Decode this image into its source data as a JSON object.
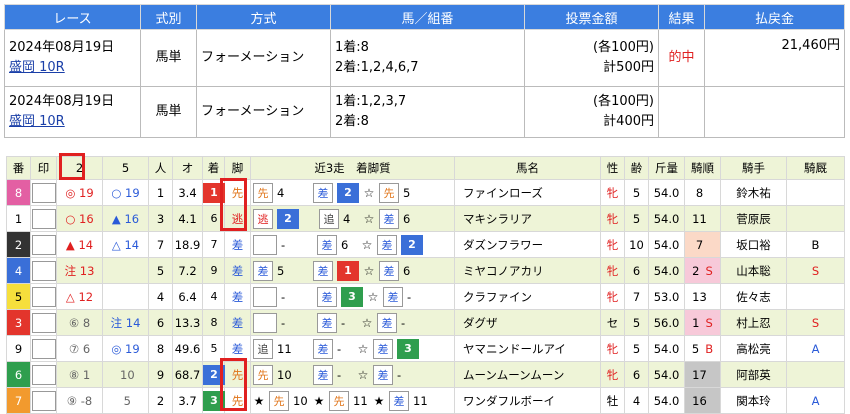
{
  "results": {
    "headers": [
      "レース",
      "式別",
      "方式",
      "馬／組番",
      "投票金額",
      "結果",
      "払戻金"
    ],
    "rows": [
      {
        "date": "2024年08月19日",
        "race": "盛岡 10R",
        "type": "馬単",
        "method": "フォーメーション",
        "combo1": "1着:8",
        "combo2": "2着:1,2,4,6,7",
        "amt1": "(各100円)",
        "amt2": "計500円",
        "result": "的中",
        "payout": "21,460円"
      },
      {
        "date": "2024年08月19日",
        "race": "盛岡 10R",
        "type": "馬単",
        "method": "フォーメーション",
        "combo1": "1着:1,2,3,7",
        "combo2": "2着:8",
        "amt1": "(各100円)",
        "amt2": "計400円",
        "result": "",
        "payout": ""
      }
    ]
  },
  "entries": {
    "headers": {
      "ban": "番",
      "mark": "印",
      "c2": "2",
      "c5": "5",
      "pop": "人",
      "odds": "オ",
      "finish": "着",
      "leg": "脚",
      "past": "近3走　着脚質",
      "name": "馬名",
      "sex": "性",
      "age": "齢",
      "weight": "斤量",
      "rider_rank": "騎順",
      "jockey": "騎手",
      "stable": "騎厩"
    },
    "rows": [
      {
        "ban": "8",
        "m2s": "◎",
        "m2n": "19",
        "m5s": "○",
        "m5n": "19",
        "pop": "1",
        "odds": "3.4",
        "fin": "1",
        "leg": "先",
        "p1s": "先",
        "p1n": "4",
        "p2s": "差",
        "p2n": "2",
        "p2f": "2",
        "p3star": "☆",
        "p3s": "先",
        "p3n": "5",
        "name": "ファインローズ",
        "sex": "牝",
        "age": "5",
        "wt": "54.0",
        "rr": "8",
        "rr_s": "",
        "jockey": "鈴木祐",
        "stable": ""
      },
      {
        "ban": "1",
        "m2s": "○",
        "m2n": "16",
        "m5s": "▲",
        "m5n": "16",
        "pop": "3",
        "odds": "4.1",
        "fin": "6",
        "leg": "逃",
        "p1s": "逃",
        "p1n": "2",
        "p1f": "2",
        "p2s": "追",
        "p2n": "4",
        "p3star": "☆",
        "p3s": "差",
        "p3n": "6",
        "name": "マキシラリア",
        "sex": "牝",
        "age": "5",
        "wt": "54.0",
        "rr": "11",
        "rr_s": "",
        "jockey": "菅原辰",
        "stable": ""
      },
      {
        "ban": "2",
        "m2s": "▲",
        "m2n": "14",
        "m5s": "△",
        "m5n": "14",
        "pop": "7",
        "odds": "18.9",
        "fin": "7",
        "leg": "差",
        "p1s": "",
        "p1n": "-",
        "p2s": "差",
        "p2n": "6",
        "p3star": "☆",
        "p3s": "差",
        "p3n": "2",
        "p3f": "2",
        "name": "ダズンフラワー",
        "sex": "牝",
        "age": "10",
        "wt": "54.0",
        "rr": "7",
        "rr_s": "",
        "jockey": "坂口裕",
        "stable": "B"
      },
      {
        "ban": "4",
        "m2s": "注",
        "m2n": "13",
        "m5s": "",
        "m5n": "",
        "pop": "5",
        "odds": "7.2",
        "fin": "9",
        "leg": "差",
        "p1s": "差",
        "p1n": "5",
        "p2s": "差",
        "p2n": "1",
        "p2f": "1",
        "p3star": "☆",
        "p3s": "差",
        "p3n": "6",
        "name": "ミヤコノアカリ",
        "sex": "牝",
        "age": "6",
        "wt": "54.0",
        "rr": "2",
        "rr_s": "S",
        "jockey": "山本聡",
        "stable": "S"
      },
      {
        "ban": "5",
        "m2s": "△",
        "m2n": "12",
        "m5s": "",
        "m5n": "",
        "pop": "4",
        "odds": "6.4",
        "fin": "4",
        "leg": "差",
        "p1s": "",
        "p1n": "-",
        "p2s": "差",
        "p2n": "3",
        "p2f": "3",
        "p3star": "☆",
        "p3s": "差",
        "p3n": "-",
        "name": "クラファイン",
        "sex": "牝",
        "age": "7",
        "wt": "53.0",
        "rr": "13",
        "rr_s": "",
        "jockey": "佐々志",
        "stable": ""
      },
      {
        "ban": "3",
        "m2s": "⑥",
        "m2n": "8",
        "m5s": "注",
        "m5n": "14",
        "pop": "6",
        "odds": "13.3",
        "fin": "8",
        "leg": "差",
        "p1s": "",
        "p1n": "-",
        "p2s": "差",
        "p2n": "-",
        "p3star": "☆",
        "p3s": "差",
        "p3n": "-",
        "name": "ダグザ",
        "sex": "セ",
        "age": "5",
        "wt": "56.0",
        "rr": "1",
        "rr_s": "S",
        "jockey": "村上忍",
        "stable": "S"
      },
      {
        "ban": "9",
        "m2s": "⑦",
        "m2n": "6",
        "m5s": "◎",
        "m5n": "19",
        "pop": "8",
        "odds": "49.6",
        "fin": "5",
        "leg": "差",
        "p1s": "追",
        "p1n": "11",
        "p2s": "差",
        "p2n": "-",
        "p3star": "☆",
        "p3s": "差",
        "p3n": "3",
        "p3f": "3",
        "name": "ヤマニンドールアイ",
        "sex": "牝",
        "age": "5",
        "wt": "54.0",
        "rr": "5",
        "rr_s": "B",
        "jockey": "高松亮",
        "stable": "A"
      },
      {
        "ban": "6",
        "m2s": "⑧",
        "m2n": "1",
        "m5s": "",
        "m5n": "10",
        "pop": "9",
        "odds": "68.7",
        "fin": "2",
        "leg": "先",
        "p1s": "先",
        "p1n": "10",
        "p2s": "差",
        "p2n": "-",
        "p3star": "☆",
        "p3s": "差",
        "p3n": "-",
        "name": "ムーンムーンムーン",
        "sex": "牝",
        "age": "6",
        "wt": "54.0",
        "rr": "17",
        "rr_s": "",
        "jockey": "阿部英",
        "stable": ""
      },
      {
        "ban": "7",
        "m2s": "⑨",
        "m2n": "-8",
        "m5s": "",
        "m5n": "5",
        "pop": "2",
        "odds": "3.7",
        "fin": "3",
        "leg": "先",
        "p1star": "★",
        "p1s": "先",
        "p1n": "10",
        "p2star": "★",
        "p2s": "先",
        "p2n": "11",
        "p3star": "★",
        "p3s": "差",
        "p3n": "11",
        "name": "ワンダフルボーイ",
        "sex": "牡",
        "age": "4",
        "wt": "54.0",
        "rr": "16",
        "rr_s": "",
        "jockey": "関本玲",
        "stable": "A"
      }
    ]
  }
}
